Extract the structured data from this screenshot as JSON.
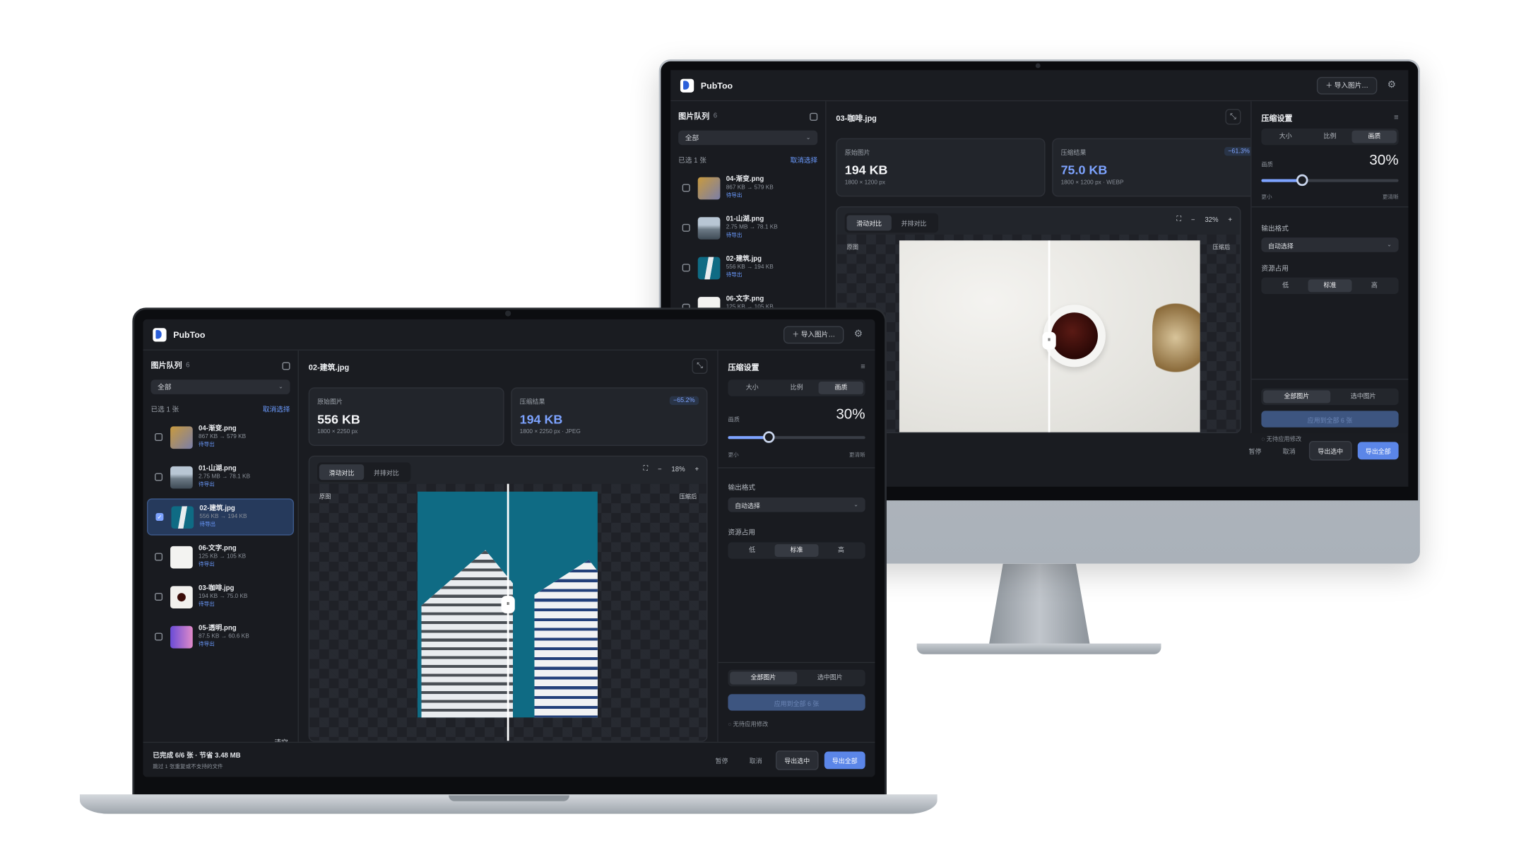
{
  "app": {
    "name": "PubToo",
    "import_label": "＋ 导入图片…"
  },
  "sidebar": {
    "title": "图片队列",
    "count": "6",
    "filter": "全部",
    "selected_info": "已选 1 张",
    "cancel_select": "取消选择",
    "clear": "清空",
    "items": [
      {
        "name": "04-渐变.png",
        "size": "867 KB → 579 KB",
        "status": "待导出"
      },
      {
        "name": "01-山湖.png",
        "size": "2.75 MB → 78.1 KB",
        "status": "待导出"
      },
      {
        "name": "02-建筑.jpg",
        "size": "556 KB → 194 KB",
        "status": "待导出"
      },
      {
        "name": "06-文字.png",
        "size": "125 KB → 105 KB",
        "status": "待导出"
      },
      {
        "name": "03-咖啡.jpg",
        "size": "194 KB → 75.0 KB",
        "status": "待导出"
      },
      {
        "name": "05-透明.png",
        "size": "87.5 KB → 60.6 KB",
        "status": "待导出"
      }
    ]
  },
  "laptop": {
    "file_title": "02-建筑.jpg",
    "original_label": "原始图片",
    "original_size": "556 KB",
    "original_dims": "1800 × 2250 px",
    "result_label": "压缩结果",
    "result_size": "194 KB",
    "result_dims": "1800 × 2250 px · JPEG",
    "reduction": "−65.2%",
    "zoom": "18%"
  },
  "monitor": {
    "file_title": "03-咖啡.jpg",
    "original_label": "原始图片",
    "original_size": "194 KB",
    "original_dims": "1800 × 1200 px",
    "result_label": "压缩结果",
    "result_size": "75.0 KB",
    "result_dims": "1800 × 1200 px · WEBP",
    "reduction": "−61.3%",
    "zoom": "32%"
  },
  "viewer": {
    "tab_slide": "滑动对比",
    "tab_side": "并排对比",
    "before_label": "原图",
    "after_label": "压缩后",
    "zoom_minus": "−",
    "zoom_plus": "+"
  },
  "settings": {
    "title": "压缩设置",
    "mode_tabs": [
      "大小",
      "比例",
      "画质"
    ],
    "active_mode": "画质",
    "quality_label": "画质",
    "quality_value": "30%",
    "quality_fraction": 0.3,
    "slider_min": "更小",
    "slider_max": "更清晰",
    "format_label": "输出格式",
    "format_value": "自动选择",
    "resource_label": "资源占用",
    "resource_options": [
      "低",
      "标准",
      "高"
    ],
    "active_resource": "标准",
    "scope_tabs": [
      "全部图片",
      "选中图片"
    ],
    "apply_label": "应用到全部 6 张",
    "no_changes": "无待应用修改"
  },
  "footer": {
    "summary": "已完成 6/6 张 · 节省 3.48 MB",
    "note": "跳过 1 张重复或不支持的文件",
    "pause": "暂停",
    "cancel": "取消",
    "export_selected": "导出选中",
    "export_all": "导出全部"
  },
  "colors": {
    "accent": "#7da3ff",
    "primary_button": "#5b86e8",
    "panel": "#1a1c21",
    "building_sky": "#0f6b84"
  }
}
